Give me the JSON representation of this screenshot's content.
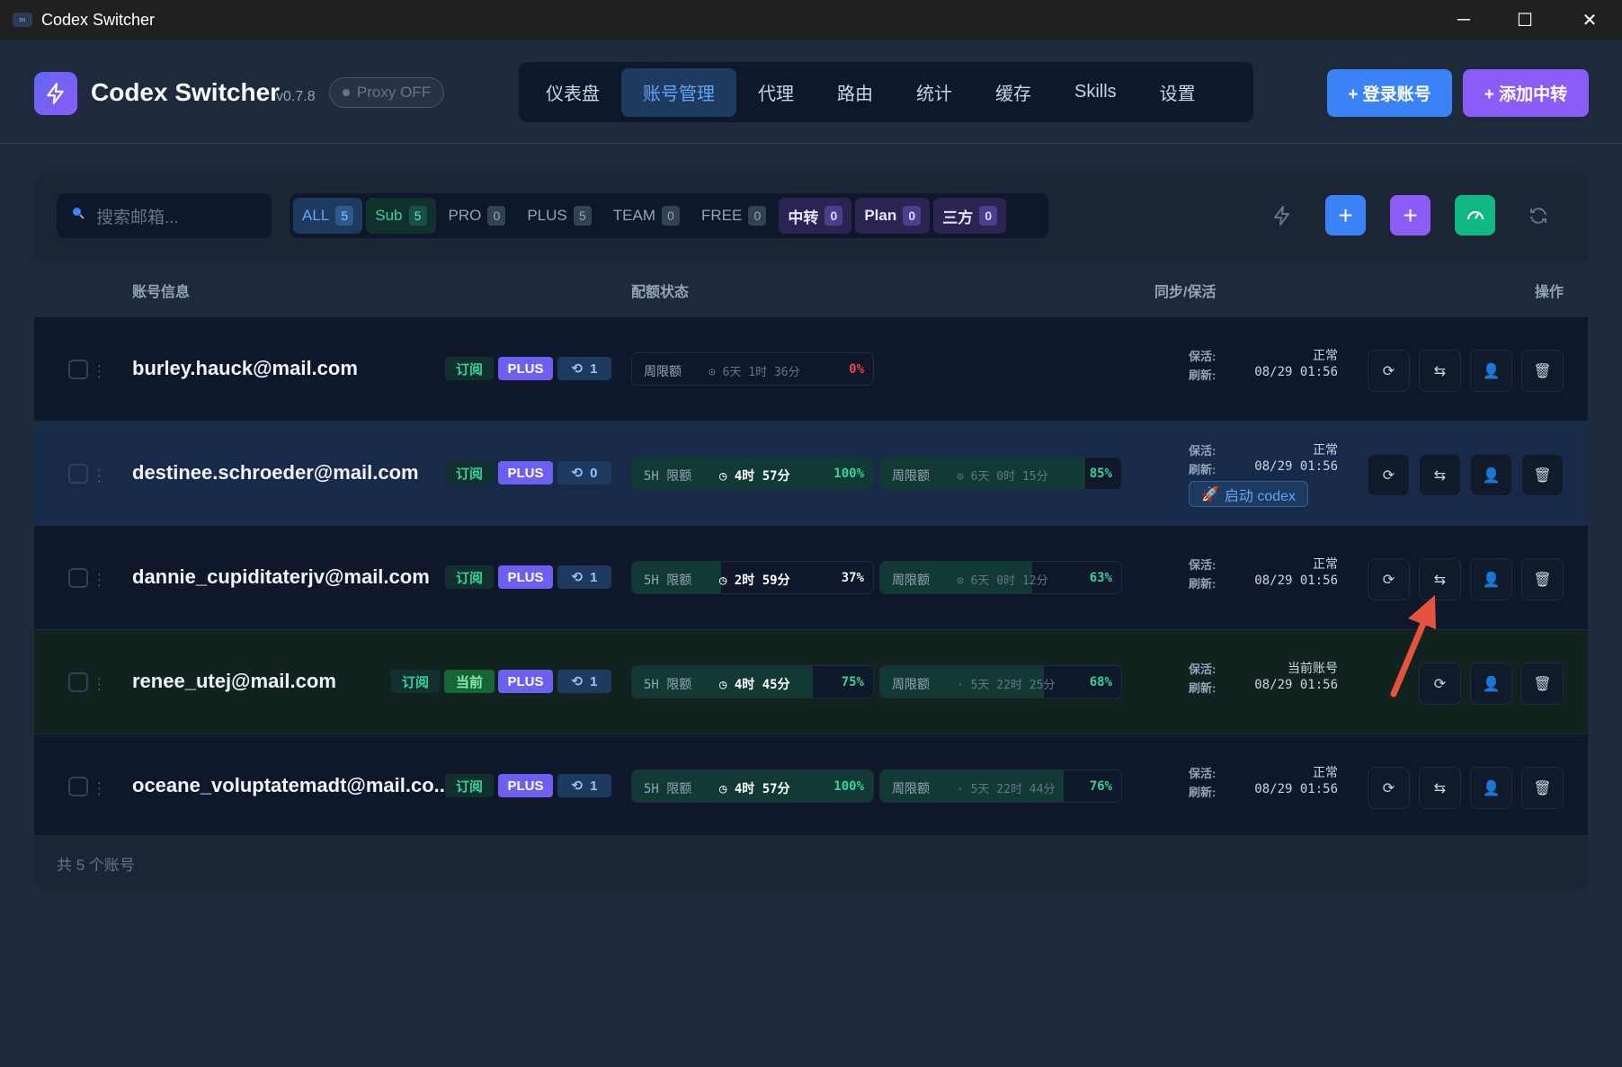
{
  "window": {
    "title": "Codex Switcher"
  },
  "app": {
    "name": "Codex Switcher",
    "version": "v0.7.8",
    "proxy_status": "Proxy OFF"
  },
  "nav": {
    "tabs": [
      "仪表盘",
      "账号管理",
      "代理",
      "路由",
      "统计",
      "缓存",
      "Skills",
      "设置"
    ],
    "active": "账号管理"
  },
  "header_buttons": {
    "login": "+ 登录账号",
    "add_relay": "+ 添加中转"
  },
  "search": {
    "placeholder": "搜索邮箱..."
  },
  "filters": [
    {
      "label": "ALL",
      "count": "5"
    },
    {
      "label": "Sub",
      "count": "5"
    },
    {
      "label": "PRO",
      "count": "0"
    },
    {
      "label": "PLUS",
      "count": "5"
    },
    {
      "label": "TEAM",
      "count": "0"
    },
    {
      "label": "FREE",
      "count": "0"
    },
    {
      "label": "中转",
      "count": "0"
    },
    {
      "label": "Plan",
      "count": "0"
    },
    {
      "label": "三方",
      "count": "0"
    }
  ],
  "columns": {
    "account": "账号信息",
    "quota": "配额状态",
    "sync": "同步/保活",
    "actions": "操作"
  },
  "sync_labels": {
    "keepalive": "保活:",
    "refresh": "刷新:"
  },
  "accounts": [
    {
      "email": "burley.hauck@mail.com",
      "tags": {
        "sub": "订阅",
        "plan": "PLUS",
        "refresh_count": "1"
      },
      "weekly": {
        "label": "周限额",
        "time": "6天 1时 36分",
        "pct": "0%",
        "fill": 0
      },
      "keepalive": "正常",
      "refreshed": "08/29 01:56"
    },
    {
      "email": "destinee.schroeder@mail.com",
      "tags": {
        "sub": "订阅",
        "plan": "PLUS",
        "refresh_count": "0"
      },
      "five_h": {
        "label": "5H 限额",
        "time": "4时 57分",
        "pct": "100%",
        "fill": 1.0
      },
      "weekly": {
        "label": "周限额",
        "time": "6天 0时 15分",
        "pct": "85%",
        "fill": 0.85
      },
      "keepalive": "正常",
      "refreshed": "08/29 01:56",
      "launch": "启动 codex"
    },
    {
      "email": "dannie_cupiditaterjv@mail.com",
      "tags": {
        "sub": "订阅",
        "plan": "PLUS",
        "refresh_count": "1"
      },
      "five_h": {
        "label": "5H 限额",
        "time": "2时 59分",
        "pct": "37%",
        "fill": 0.37
      },
      "weekly": {
        "label": "周限额",
        "time": "6天 0时 12分",
        "pct": "63%",
        "fill": 0.63
      },
      "keepalive": "正常",
      "refreshed": "08/29 01:56"
    },
    {
      "email": "renee_utej@mail.com",
      "tags": {
        "sub": "订阅",
        "current": "当前",
        "plan": "PLUS",
        "refresh_count": "1"
      },
      "five_h": {
        "label": "5H 限额",
        "time": "4时 45分",
        "pct": "75%",
        "fill": 0.75
      },
      "weekly": {
        "label": "周限额",
        "time": "5天 22时 25分",
        "pct": "68%",
        "fill": 0.68
      },
      "keepalive": "当前账号",
      "refreshed": "08/29 01:56"
    },
    {
      "email": "oceane_voluptatemadt@mail.co...",
      "tags": {
        "sub": "订阅",
        "plan": "PLUS",
        "refresh_count": "1"
      },
      "five_h": {
        "label": "5H 限额",
        "time": "4时 57分",
        "pct": "100%",
        "fill": 1.0
      },
      "weekly": {
        "label": "周限额",
        "time": "5天 22时 44分",
        "pct": "76%",
        "fill": 0.76
      },
      "keepalive": "正常",
      "refreshed": "08/29 01:56"
    }
  ],
  "footer": {
    "total": "共 5 个账号"
  },
  "colors": {
    "accent_blue": "#3b82f6",
    "accent_purple": "#8b5cf6",
    "accent_green": "#10b981",
    "annotation_arrow": "#e5533d"
  }
}
